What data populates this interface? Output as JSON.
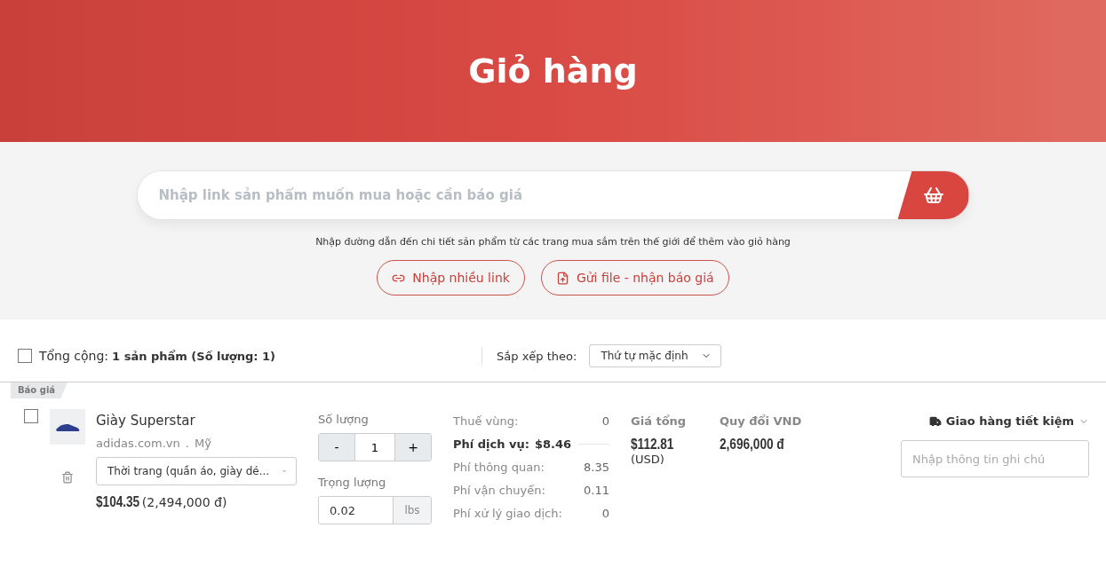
{
  "hero": {
    "title": "Giỏ hàng"
  },
  "search": {
    "placeholder": "Nhập link sản phẩm muốn mua hoặc cần báo giá",
    "hint": "Nhập đường dẫn đến chi tiết sản phẩm từ các trang mua sắm trên thế giới để thêm vào giỏ hàng",
    "buttons": [
      {
        "kind": "link",
        "label": "Nhập nhiều link"
      },
      {
        "kind": "file",
        "label": "Gửi file - nhận báo giá"
      }
    ]
  },
  "summary": {
    "checked": false,
    "label": "Tổng cộng:",
    "value": "1 sản phẩm (Số lượng: 1)",
    "sort_label": "Sắp xếp theo:",
    "sort_value": "Thứ tự mặc định"
  },
  "group": {
    "tag": "Báo giá"
  },
  "item": {
    "checked": false,
    "name": "Giày Superstar",
    "store": "adidas.com.vn",
    "separator": ".",
    "country": "Mỹ",
    "category": "Thời trang (quần áo, giày dé...",
    "price": "$104.35",
    "price_vnd": "(2,494,000 đ)",
    "quantity_label": "Số lượng",
    "minus": "-",
    "quantity": "1",
    "plus": "+",
    "weight_label": "Trọng lượng",
    "weight": "0.02",
    "weight_unit": "lbs",
    "fees": [
      {
        "kind": "plain",
        "label": "Thuế vùng:",
        "value": "0"
      },
      {
        "kind": "header",
        "label": "Phí dịch vụ:",
        "value": "$8.46"
      },
      {
        "kind": "plain",
        "label": "Phí thông quan:",
        "value": "8.35"
      },
      {
        "kind": "plain",
        "label": "Phí vận chuyển:",
        "value": "0.11"
      },
      {
        "kind": "plain",
        "label": "Phí xử lý giao dịch:",
        "value": "0"
      }
    ],
    "total_label": "Giá tổng",
    "total": "$112.81",
    "total_currency": "(USD)",
    "vnd_label": "Quy đổi VND",
    "vnd": "2,696,000 đ",
    "shipping": "Giao hàng tiết kiệm",
    "note_placeholder": "Nhập thông tin ghi chú"
  }
}
